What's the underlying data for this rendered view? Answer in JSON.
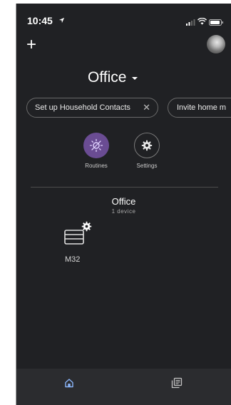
{
  "status_bar": {
    "time": "10:45",
    "icons": [
      "location-arrow-icon",
      "cellular-signal-icon",
      "wifi-icon",
      "battery-icon"
    ]
  },
  "header": {
    "add_label": "+",
    "home_name": "Office",
    "avatar_icon": "profile-avatar"
  },
  "chips": [
    {
      "label": "Set up Household Contacts",
      "close_label": "✕"
    },
    {
      "label": "Invite home m"
    }
  ],
  "actions": [
    {
      "label": "Routines",
      "icon": "sun-icon",
      "color": "#6a4c93"
    },
    {
      "label": "Settings",
      "icon": "gear-icon"
    }
  ],
  "room": {
    "name": "Office",
    "device_count": "1 device"
  },
  "devices": [
    {
      "name": "M32",
      "icon": "router-icon",
      "badge_icon": "gear-icon"
    }
  ],
  "bottom_nav": {
    "items": [
      "home-icon",
      "feed-icon"
    ],
    "active_color": "#8ab4f8"
  }
}
